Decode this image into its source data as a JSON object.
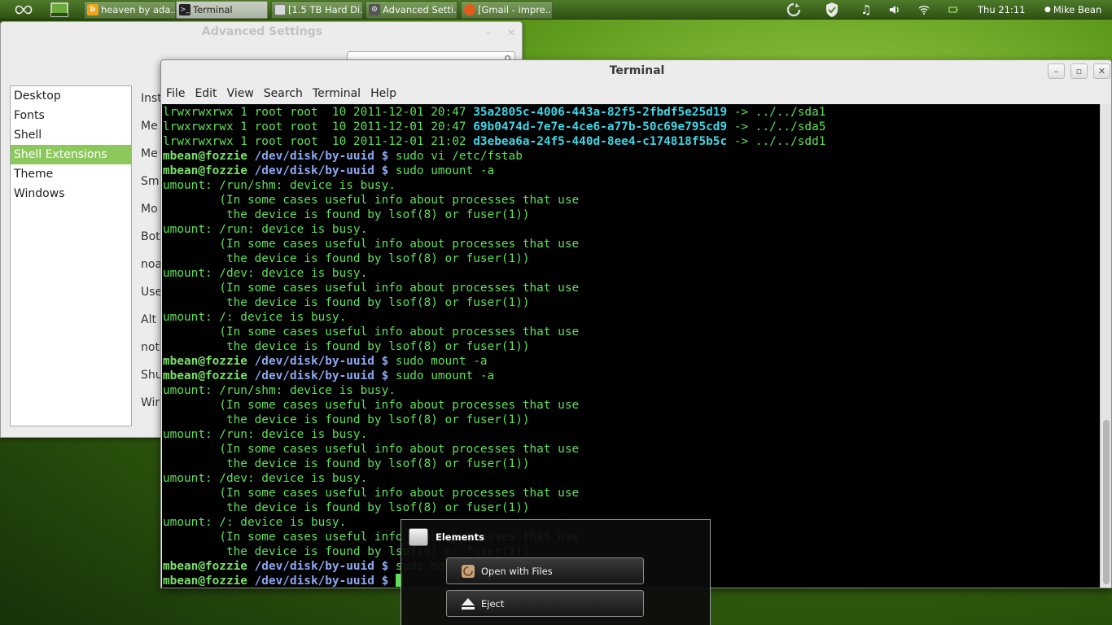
{
  "top_panel": {
    "tasks": [
      {
        "label": "heaven by ada...",
        "icon": "book-icon"
      },
      {
        "label": "Terminal",
        "icon": "terminal-icon"
      },
      {
        "label": "[1.5 TB Hard Di...",
        "icon": "drive-icon"
      },
      {
        "label": "Advanced Setti...",
        "icon": "settings-icon"
      },
      {
        "label": "[Gmail - impre...",
        "icon": "browser-icon"
      }
    ],
    "clock": "Thu 21:11",
    "user": "Mike Bean"
  },
  "advanced_settings": {
    "title": "Advanced Settings",
    "sidebar": [
      "Desktop",
      "Fonts",
      "Shell",
      "Shell Extensions",
      "Theme",
      "Windows"
    ],
    "selected": "Shell Extensions",
    "row_labels": [
      "Inst",
      "Me",
      "Me",
      "Sm",
      "Mo",
      "Bot",
      "noa",
      "Use",
      "Alt",
      "not",
      "Shu",
      "Wir"
    ]
  },
  "terminal": {
    "title": "Terminal",
    "menu": [
      "File",
      "Edit",
      "View",
      "Search",
      "Terminal",
      "Help"
    ],
    "lines": [
      [
        {
          "t": "lrwxrwxrwx 1 root root  10 2011-12-01 20:47 "
        },
        {
          "t": "35a2805c-4006-443a-82f5-2fbdf5e25d19",
          "c": "cyan"
        },
        {
          "t": " -> ../../sda1"
        }
      ],
      [
        {
          "t": "lrwxrwxrwx 1 root root  10 2011-12-01 20:47 "
        },
        {
          "t": "69b0474d-7e7e-4ce6-a77b-50c69e795cd9",
          "c": "cyan"
        },
        {
          "t": " -> ../../sda5"
        }
      ],
      [
        {
          "t": "lrwxrwxrwx 1 root root  10 2011-12-01 21:02 "
        },
        {
          "t": "d3ebea6a-24f5-440d-8ee4-c174818f5b5c",
          "c": "cyan"
        },
        {
          "t": " -> ../../sdd1"
        }
      ],
      [
        {
          "t": "mbean@fozzie",
          "c": "bold"
        },
        {
          "t": " /dev/disk/by-uuid $",
          "c": "path"
        },
        {
          "t": " sudo vi /etc/fstab"
        }
      ],
      [
        {
          "t": "mbean@fozzie",
          "c": "bold"
        },
        {
          "t": " /dev/disk/by-uuid $",
          "c": "path"
        },
        {
          "t": " sudo umount -a"
        }
      ],
      [
        {
          "t": "umount: /run/shm: device is busy."
        }
      ],
      [
        {
          "t": "        (In some cases useful info about processes that use"
        }
      ],
      [
        {
          "t": "         the device is found by lsof(8) or fuser(1))"
        }
      ],
      [
        {
          "t": "umount: /run: device is busy."
        }
      ],
      [
        {
          "t": "        (In some cases useful info about processes that use"
        }
      ],
      [
        {
          "t": "         the device is found by lsof(8) or fuser(1))"
        }
      ],
      [
        {
          "t": "umount: /dev: device is busy."
        }
      ],
      [
        {
          "t": "        (In some cases useful info about processes that use"
        }
      ],
      [
        {
          "t": "         the device is found by lsof(8) or fuser(1))"
        }
      ],
      [
        {
          "t": "umount: /: device is busy."
        }
      ],
      [
        {
          "t": "        (In some cases useful info about processes that use"
        }
      ],
      [
        {
          "t": "         the device is found by lsof(8) or fuser(1))"
        }
      ],
      [
        {
          "t": "mbean@fozzie",
          "c": "bold"
        },
        {
          "t": " /dev/disk/by-uuid $",
          "c": "path"
        },
        {
          "t": " sudo mount -a"
        }
      ],
      [
        {
          "t": "mbean@fozzie",
          "c": "bold"
        },
        {
          "t": " /dev/disk/by-uuid $",
          "c": "path"
        },
        {
          "t": " sudo umount -a"
        }
      ],
      [
        {
          "t": "umount: /run/shm: device is busy."
        }
      ],
      [
        {
          "t": "        (In some cases useful info about processes that use"
        }
      ],
      [
        {
          "t": "         the device is found by lsof(8) or fuser(1))"
        }
      ],
      [
        {
          "t": "umount: /run: device is busy."
        }
      ],
      [
        {
          "t": "        (In some cases useful info about processes that use"
        }
      ],
      [
        {
          "t": "         the device is found by lsof(8) or fuser(1))"
        }
      ],
      [
        {
          "t": "umount: /dev: device is busy."
        }
      ],
      [
        {
          "t": "        (In some cases useful info about processes that use"
        }
      ],
      [
        {
          "t": "         the device is found by lsof(8) or fuser(1))"
        }
      ],
      [
        {
          "t": "umount: /: device is busy."
        }
      ],
      [
        {
          "t": "        (In some cases useful info about processes that use"
        }
      ],
      [
        {
          "t": "         the device is found by lsof(8) or fuser(1))"
        }
      ],
      [
        {
          "t": "mbean@fozzie",
          "c": "bold"
        },
        {
          "t": " /dev/disk/by-uuid $",
          "c": "path"
        },
        {
          "t": " sudo mount -a"
        }
      ],
      [
        {
          "t": "mbean@fozzie",
          "c": "bold"
        },
        {
          "t": " /dev/disk/by-uuid $",
          "c": "path"
        },
        {
          "t": " "
        }
      ]
    ]
  },
  "elements_popup": {
    "title": "Elements",
    "open_label": "Open with Files",
    "eject_label": "Eject"
  },
  "colors": {
    "terminal_text": "#5fe05a",
    "prompt_user": "#7be06a",
    "prompt_path": "#8da8f0",
    "link_target": "#3fd6e6",
    "sidebar_selected": "#8cc85c"
  }
}
